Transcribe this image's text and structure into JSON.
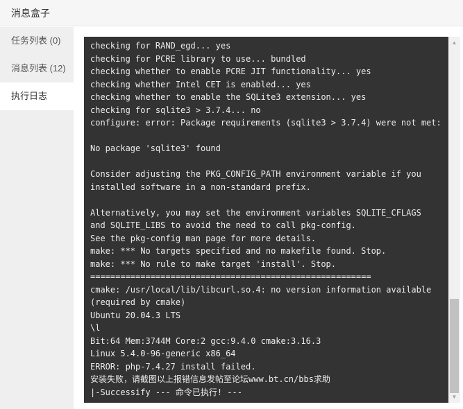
{
  "window": {
    "title": "消息盒子"
  },
  "sidebar": {
    "items": [
      {
        "label": "任务列表 (0)",
        "active": false
      },
      {
        "label": "消息列表 (12)",
        "active": false
      },
      {
        "label": "执行日志",
        "active": true
      }
    ]
  },
  "console": {
    "lines": [
      "checking for RAND_egd... yes",
      "checking for PCRE library to use... bundled",
      "checking whether to enable PCRE JIT functionality... yes",
      "checking whether Intel CET is enabled... yes",
      "checking whether to enable the SQLite3 extension... yes",
      "checking for sqlite3 > 3.7.4... no",
      "configure: error: Package requirements (sqlite3 > 3.7.4) were not met:",
      "",
      "No package 'sqlite3' found",
      "",
      "Consider adjusting the PKG_CONFIG_PATH environment variable if you",
      "installed software in a non-standard prefix.",
      "",
      "Alternatively, you may set the environment variables SQLITE_CFLAGS",
      "and SQLITE_LIBS to avoid the need to call pkg-config.",
      "See the pkg-config man page for more details.",
      "make: *** No targets specified and no makefile found. Stop.",
      "make: *** No rule to make target 'install'. Stop.",
      "========================================================",
      "cmake: /usr/local/lib/libcurl.so.4: no version information available",
      "(required by cmake)",
      "Ubuntu 20.04.3 LTS",
      "\\l",
      "Bit:64 Mem:3744M Core:2 gcc:9.4.0 cmake:3.16.3",
      "Linux 5.4.0-96-generic x86_64",
      "ERROR: php-7.4.27 install failed.",
      "安装失败，请截图以上报错信息发帖至论坛www.bt.cn/bbs求助",
      "|-Successify --- 命令已执行! ---"
    ]
  },
  "scrollbar": {
    "up_arrow": "▲",
    "down_arrow": "▼",
    "scroll_position": 1.0
  }
}
